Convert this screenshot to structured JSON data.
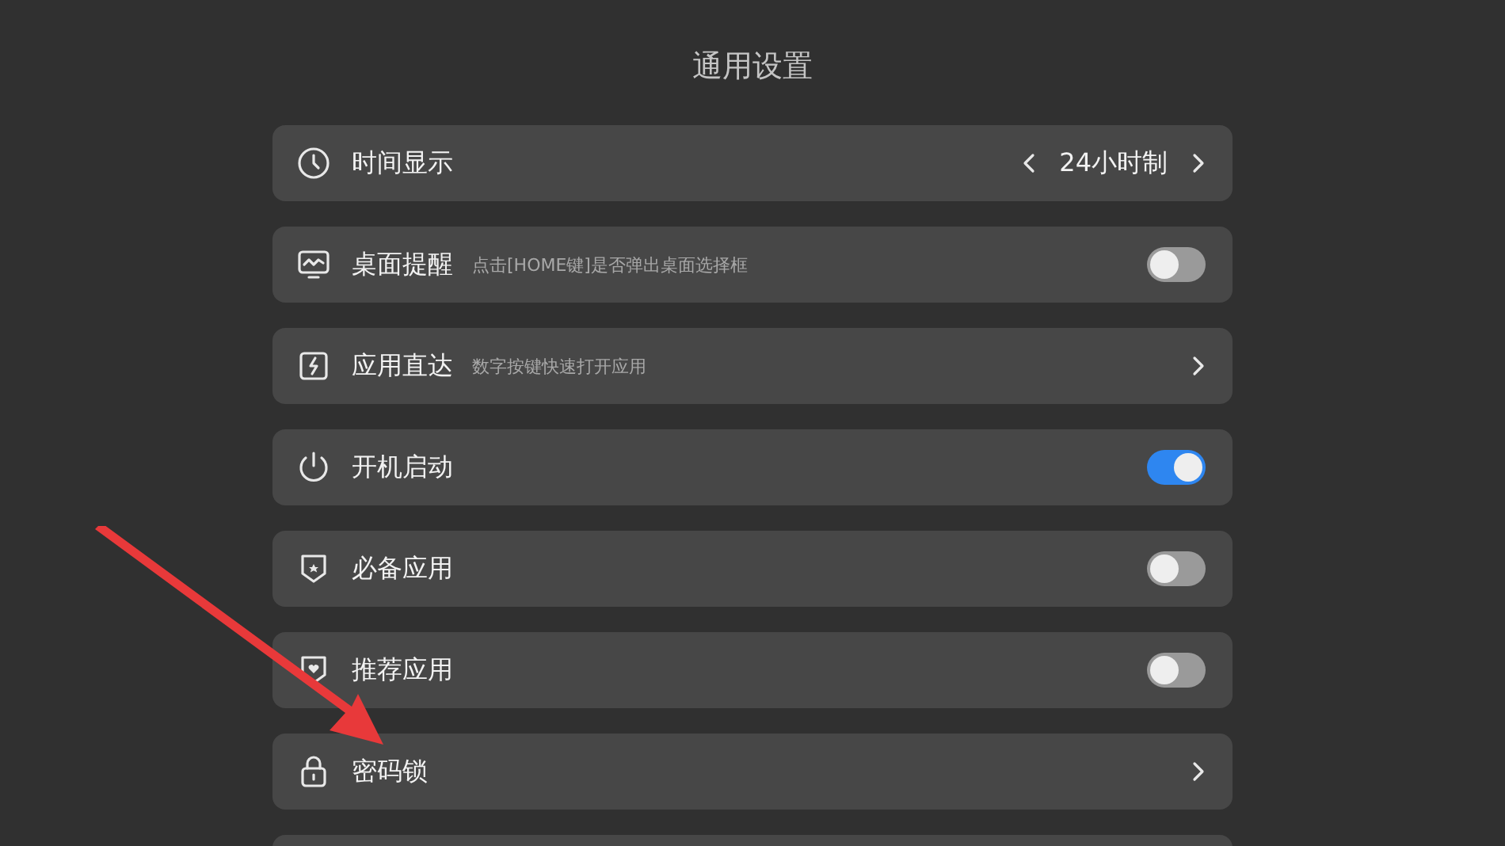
{
  "title": "通用设置",
  "rows": [
    {
      "kind": "selector",
      "label": "时间显示",
      "value": "24小时制"
    },
    {
      "kind": "toggle",
      "label": "桌面提醒",
      "description": "点击[HOME键]是否弹出桌面选择框",
      "on": false
    },
    {
      "kind": "link",
      "label": "应用直达",
      "description": "数字按键快速打开应用"
    },
    {
      "kind": "toggle",
      "label": "开机启动",
      "on": true
    },
    {
      "kind": "toggle",
      "label": "必备应用",
      "on": false
    },
    {
      "kind": "toggle",
      "label": "推荐应用",
      "on": false
    },
    {
      "kind": "link",
      "label": "密码锁"
    }
  ]
}
